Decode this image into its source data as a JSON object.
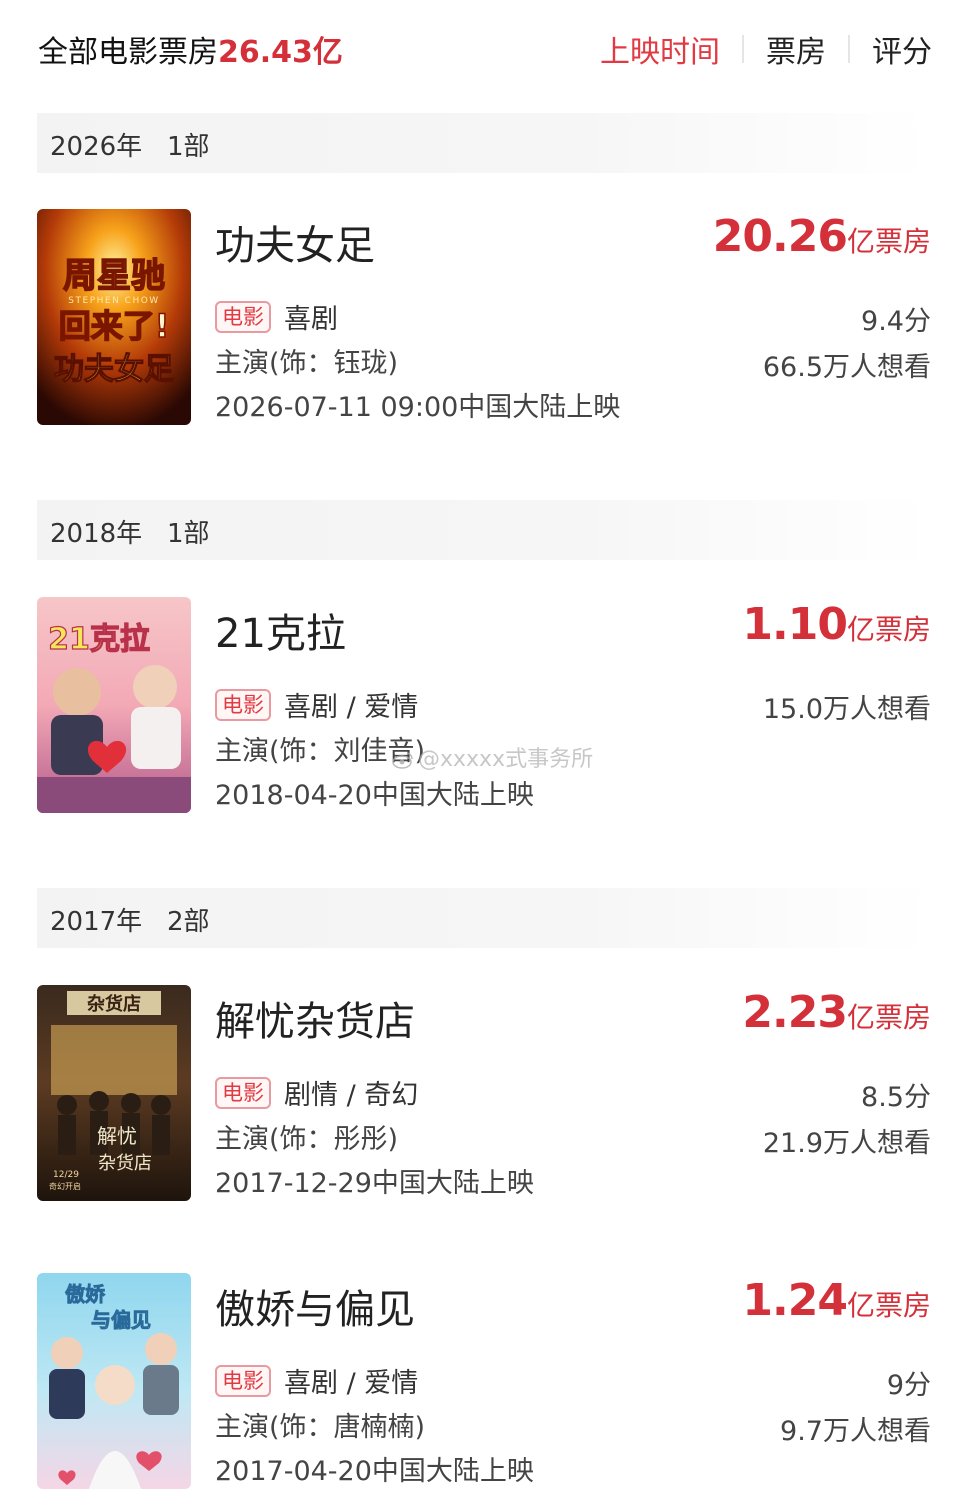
{
  "header": {
    "total_label": "全部电影票房",
    "total_amount": "26.43亿",
    "tabs": [
      {
        "label": "上映时间",
        "active": true
      },
      {
        "label": "票房",
        "active": false
      },
      {
        "label": "评分",
        "active": false
      }
    ]
  },
  "groups": [
    {
      "year_label": "2026年   1部"
    },
    {
      "year_label": "2018年   1部"
    },
    {
      "year_label": "2017年   2部"
    }
  ],
  "movies": [
    {
      "title": "功夫女足",
      "tag": "电影",
      "genre": "喜剧",
      "actor": "主演(饰：钰珑)",
      "date": "2026-07-11 09:00中国大陆上映",
      "box_value": "20.26",
      "box_unit": "亿票房",
      "score": "9.4分",
      "want": "66.5万人想看",
      "poster_text": [
        "周星驰",
        "STEPHEN CHOW",
        "回来了!",
        "功夫女足"
      ]
    },
    {
      "title": "21克拉",
      "tag": "电影",
      "genre": "喜剧 / 爱情",
      "actor": "主演(饰：刘佳音)",
      "date": "2018-04-20中国大陆上映",
      "box_value": "1.10",
      "box_unit": "亿票房",
      "score": "",
      "want": "15.0万人想看",
      "poster_text": [
        "21克拉"
      ]
    },
    {
      "title": "解忧杂货店",
      "tag": "电影",
      "genre": "剧情 / 奇幻",
      "actor": "主演(饰：彤彤)",
      "date": "2017-12-29中国大陆上映",
      "box_value": "2.23",
      "box_unit": "亿票房",
      "score": "8.5分",
      "want": "21.9万人想看",
      "poster_text": [
        "杂货店",
        "解忧",
        "杂货店",
        "12/29",
        "奇幻开启"
      ]
    },
    {
      "title": "傲娇与偏见",
      "tag": "电影",
      "genre": "喜剧 / 爱情",
      "actor": "主演(饰：唐楠楠)",
      "date": "2017-04-20中国大陆上映",
      "box_value": "1.24",
      "box_unit": "亿票房",
      "score": "9分",
      "want": "9.7万人想看",
      "poster_text": [
        "傲娇",
        "与偏见"
      ]
    }
  ],
  "watermark": "@xxxxx式事务所",
  "colors": {
    "accent": "#e23a43",
    "box_office": "#d4303a",
    "year_bar": "#f3f3f3"
  }
}
